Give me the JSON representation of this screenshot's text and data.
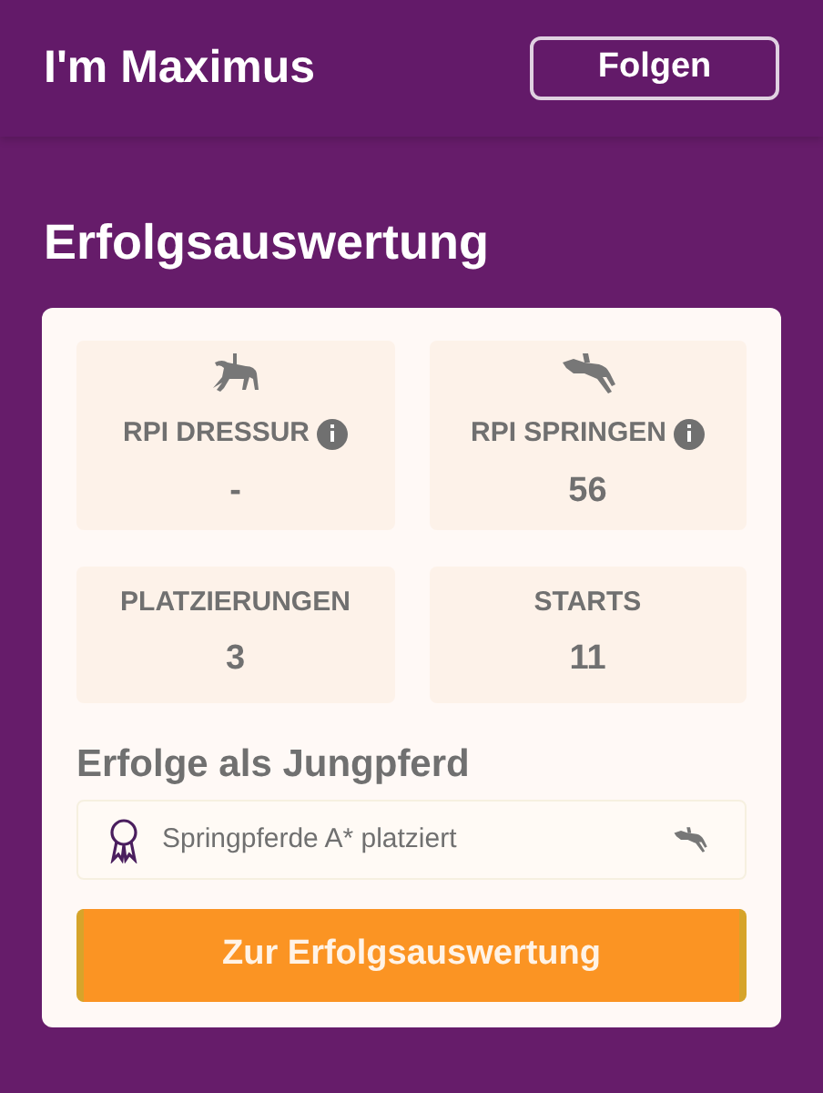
{
  "header": {
    "title": "I'm Maximus",
    "follow_button": "Folgen"
  },
  "section_title": "Erfolgsauswertung",
  "stats": [
    {
      "kind": "dressage",
      "label": "RPI DRESSUR",
      "info": true,
      "value": "-"
    },
    {
      "kind": "jumping",
      "label": "RPI SPRINGEN",
      "info": true,
      "value": "56"
    },
    {
      "kind": "plain",
      "label": "PLATZIERUNGEN",
      "info": false,
      "value": "3"
    },
    {
      "kind": "plain",
      "label": "STARTS",
      "info": false,
      "value": "11"
    }
  ],
  "young_horse": {
    "title": "Erfolge als Jungpferd",
    "items": [
      {
        "text": "Springpferde A* platziert"
      }
    ]
  },
  "cta_button": "Zur Erfolgsauswertung"
}
